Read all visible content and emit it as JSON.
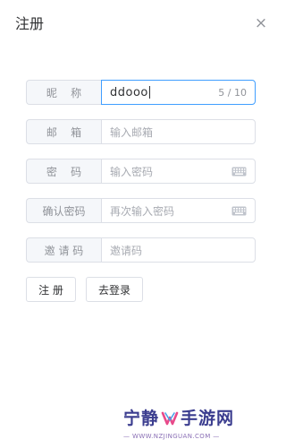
{
  "dialog": {
    "title": "注册",
    "close_symbol": "×"
  },
  "form": {
    "nickname": {
      "label": "昵    称",
      "value": "ddooo",
      "counter": "5 / 10"
    },
    "email": {
      "label": "邮    箱",
      "placeholder": "输入邮箱"
    },
    "password": {
      "label": "密    码",
      "placeholder": "输入密码",
      "icon": "keyboard-icon"
    },
    "confirm_password": {
      "label": "确认密码",
      "placeholder": "再次输入密码",
      "icon": "keyboard-icon"
    },
    "invite_code": {
      "label": "邀 请 码",
      "placeholder": "邀请码"
    }
  },
  "buttons": {
    "register_label": "注 册",
    "login_label": "去登录"
  },
  "watermark": {
    "left_text": "宁静",
    "right_text": "手游网",
    "url": "— WWW.NZJINGUAN.COM —"
  },
  "colors": {
    "focus_border": "#409eff",
    "border": "#dcdfe6",
    "label_bg": "#f5f7fa",
    "watermark_text": "#3b3d8f"
  }
}
